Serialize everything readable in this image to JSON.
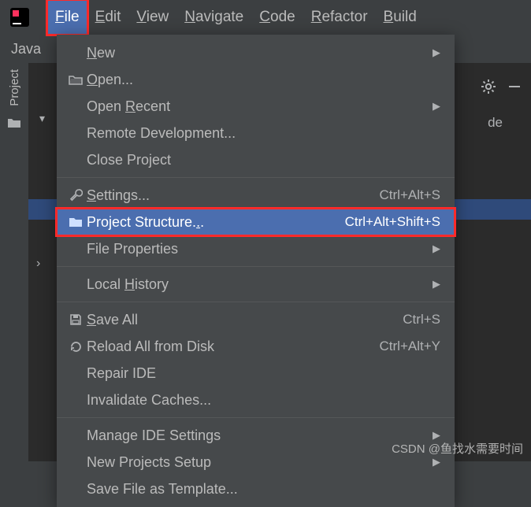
{
  "menubar": {
    "items": [
      {
        "label": "File",
        "mnemonic_index": 0
      },
      {
        "label": "Edit",
        "mnemonic_index": 0
      },
      {
        "label": "View",
        "mnemonic_index": 0
      },
      {
        "label": "Navigate",
        "mnemonic_index": 0
      },
      {
        "label": "Code",
        "mnemonic_index": 0
      },
      {
        "label": "Refactor",
        "mnemonic_index": 0
      },
      {
        "label": "Build",
        "mnemonic_index": 0
      }
    ],
    "active_index": 0
  },
  "project_tool": {
    "label": "Project",
    "tab_label": "Java"
  },
  "editor": {
    "hint_right": "de"
  },
  "dropdown": {
    "groups": [
      [
        {
          "label": "New",
          "mnemonic_index": 0,
          "submenu": true
        },
        {
          "icon": "folder-open-icon",
          "label": "Open...",
          "mnemonic_index": 0
        },
        {
          "label": "Open Recent",
          "mnemonic_index": 5,
          "submenu": true
        },
        {
          "label": "Remote Development..."
        },
        {
          "label": "Close Project"
        }
      ],
      [
        {
          "icon": "wrench-icon",
          "label": "Settings...",
          "mnemonic_index": 0,
          "shortcut": "Ctrl+Alt+S"
        },
        {
          "icon": "folder-fill-icon",
          "label": "Project Structure...",
          "mnemonic_index": 18,
          "shortcut": "Ctrl+Alt+Shift+S",
          "selected": true
        },
        {
          "label": "File Properties",
          "submenu": true
        }
      ],
      [
        {
          "label": "Local History",
          "mnemonic_index": 6,
          "submenu": true
        }
      ],
      [
        {
          "icon": "save-icon",
          "label": "Save All",
          "mnemonic_index": 0,
          "shortcut": "Ctrl+S"
        },
        {
          "icon": "reload-icon",
          "label": "Reload All from Disk",
          "shortcut": "Ctrl+Alt+Y"
        },
        {
          "label": "Repair IDE"
        },
        {
          "label": "Invalidate Caches..."
        }
      ],
      [
        {
          "label": "Manage IDE Settings",
          "submenu": true
        },
        {
          "label": "New Projects Setup",
          "submenu": true
        },
        {
          "label": "Save File as Template..."
        }
      ]
    ]
  },
  "watermark": "CSDN @鱼找水需要时间"
}
